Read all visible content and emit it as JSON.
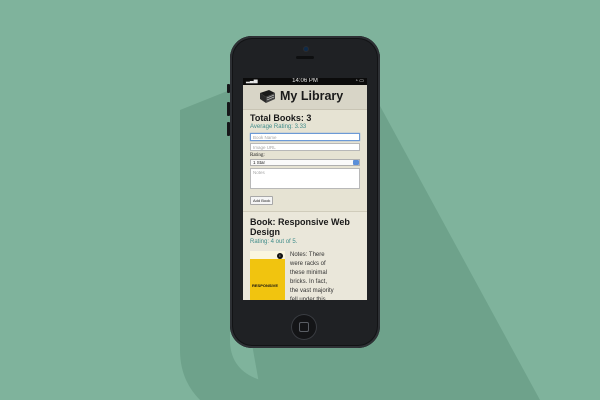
{
  "colors": {
    "background": "#7fb39c",
    "shadow": "#6a9d86",
    "accent": "#3f8c8a"
  },
  "status_bar": {
    "time": "14:06 PM"
  },
  "app": {
    "title": "My Library",
    "icon": "book-icon"
  },
  "summary": {
    "total_books": "Total Books: 3",
    "average_rating": "Average Rating: 3.33"
  },
  "form": {
    "book_name_placeholder": "Book Name",
    "image_url_placeholder": "Image URL",
    "rating_label": "Rating:",
    "rating_selected": "1 Star",
    "notes_placeholder": "Notes",
    "add_button": "Add Book"
  },
  "book": {
    "title": "Book: Responsive Web Design",
    "rating": "Rating: 4 out of 5.",
    "cover_title": "RESPONSIVE",
    "notes": "Notes: There were racks of these minimal bricks. In fact, the vast majority fell under this careful"
  }
}
